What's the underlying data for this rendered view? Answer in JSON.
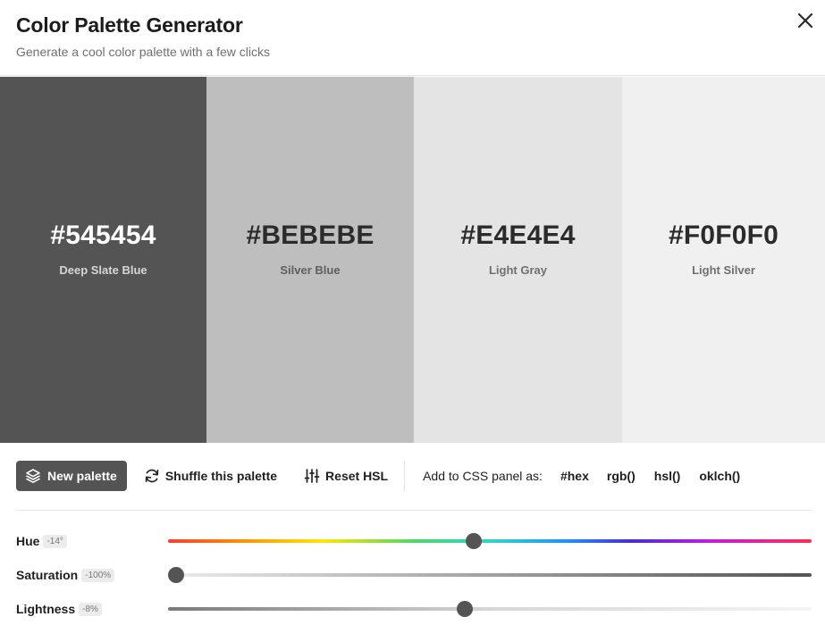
{
  "header": {
    "title": "Color Palette Generator",
    "subtitle": "Generate a cool color palette with a few clicks"
  },
  "icons": {
    "close": "close-icon",
    "new_palette": "layers-icon",
    "shuffle": "refresh-icon",
    "reset": "sliders-icon"
  },
  "palette": [
    {
      "hex": "#545454",
      "name": "Deep Slate Blue",
      "bg": "#545454",
      "text": "#ffffff",
      "subtext": "#d6d6d6"
    },
    {
      "hex": "#BEBEBE",
      "name": "Silver Blue",
      "bg": "#bebebe",
      "text": "#2b2b2b",
      "subtext": "#5f5f5f"
    },
    {
      "hex": "#E4E4E4",
      "name": "Light Gray",
      "bg": "#e4e4e4",
      "text": "#2b2b2b",
      "subtext": "#6f6f6f"
    },
    {
      "hex": "#F0F0F0",
      "name": "Light Silver",
      "bg": "#f0f0f0",
      "text": "#2b2b2b",
      "subtext": "#6f6f6f"
    }
  ],
  "toolbar": {
    "new_palette_label": "New palette",
    "shuffle_label": "Shuffle this palette",
    "reset_label": "Reset HSL",
    "css_label": "Add to CSS panel as:",
    "formats": [
      "#hex",
      "rgb()",
      "hsl()",
      "oklch()"
    ]
  },
  "sliders": {
    "hue": {
      "label": "Hue",
      "badge": "-14°",
      "value": 0.475
    },
    "saturation": {
      "label": "Saturation",
      "badge": "-100%",
      "value": 0.0
    },
    "lightness": {
      "label": "Lightness",
      "badge": "-8%",
      "value": 0.46
    }
  },
  "colors": {
    "accent": "#545454",
    "divider": "#e2e2e2"
  }
}
